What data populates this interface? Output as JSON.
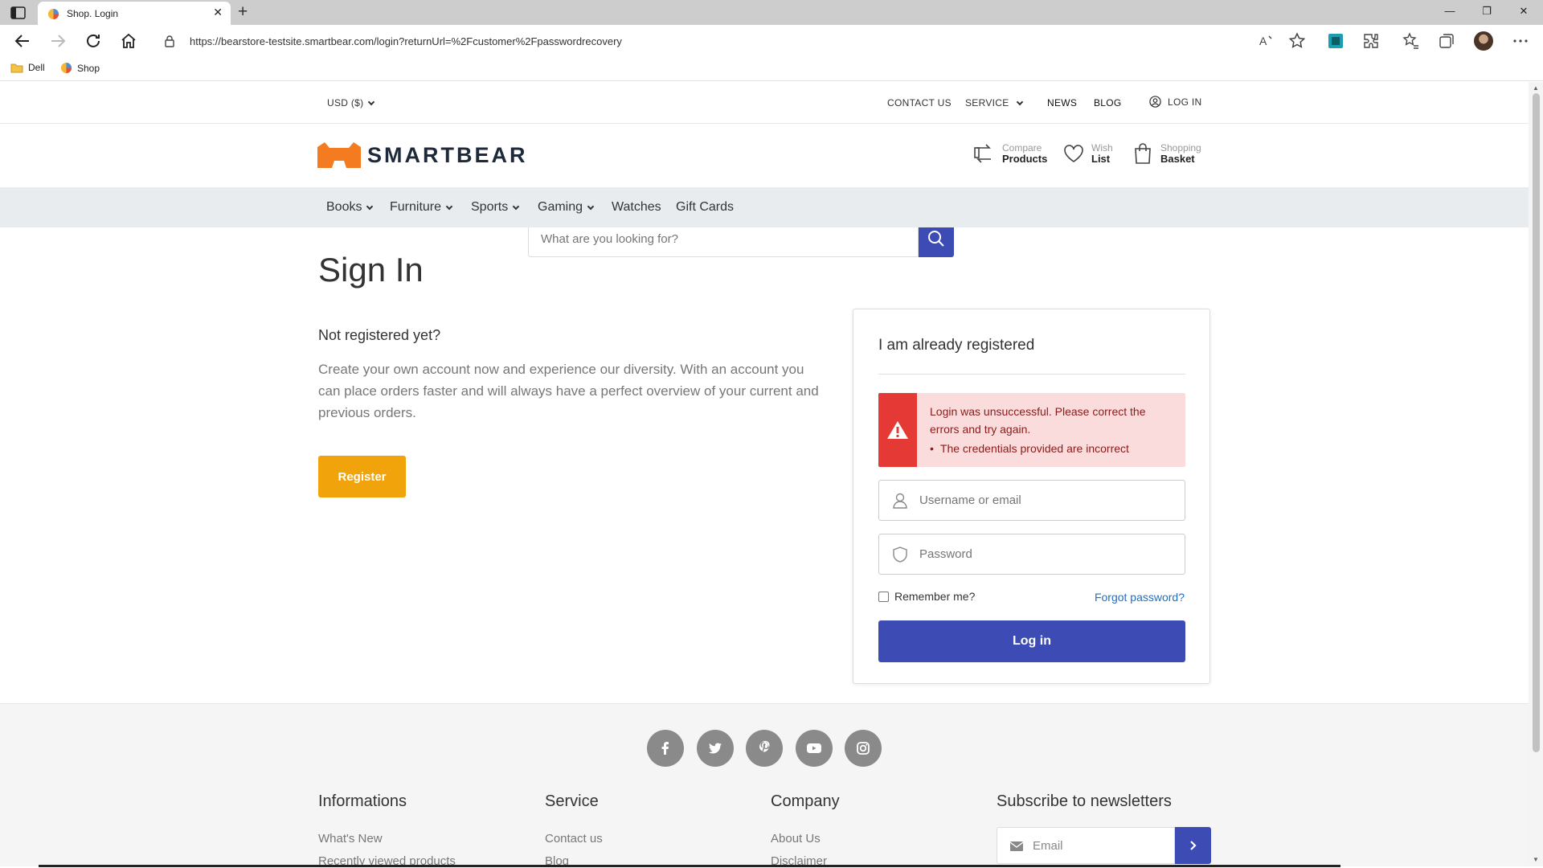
{
  "browser": {
    "tab_title": "Shop. Login",
    "url": "https://bearstore-testsite.smartbear.com/login?returnUrl=%2Fcustomer%2Fpasswordrecovery",
    "bookmarks": [
      {
        "label": "Dell",
        "icon": "folder-icon"
      },
      {
        "label": "Shop",
        "icon": "shop-favicon"
      }
    ]
  },
  "topbar": {
    "currency": "USD ($)",
    "contact": "CONTACT US",
    "service": "SERVICE",
    "news": "NEWS",
    "blog": "BLOG",
    "login": "LOG IN"
  },
  "header": {
    "logo_text": "SMARTBEAR",
    "search_placeholder": "What are you looking for?",
    "compare": {
      "small": "Compare",
      "big": "Products"
    },
    "wish": {
      "small": "Wish",
      "big": "List"
    },
    "basket": {
      "small": "Shopping",
      "big": "Basket"
    }
  },
  "categories": [
    "Books",
    "Furniture",
    "Sports",
    "Gaming",
    "Watches",
    "Gift Cards"
  ],
  "main": {
    "title": "Sign In",
    "not_registered": "Not registered yet?",
    "register_text": "Create your own account now and experience our diversity. With an account you can place orders faster and will always have a perfect overview of your current and previous orders.",
    "register_button": "Register"
  },
  "login": {
    "title": "I am already registered",
    "error_message": "Login was unsuccessful. Please correct the errors and try again.",
    "error_detail": "The credentials provided are incorrect",
    "username_placeholder": "Username or email",
    "password_placeholder": "Password",
    "remember": "Remember me?",
    "forgot": "Forgot password?",
    "button": "Log in"
  },
  "footer": {
    "socials": [
      "facebook-icon",
      "twitter-icon",
      "pinterest-icon",
      "youtube-icon",
      "instagram-icon"
    ],
    "informations": {
      "title": "Informations",
      "links": [
        "What's New",
        "Recently viewed products"
      ]
    },
    "service": {
      "title": "Service",
      "links": [
        "Contact us",
        "Blog"
      ]
    },
    "company": {
      "title": "Company",
      "links": [
        "About Us",
        "Disclaimer"
      ]
    },
    "newsletter": {
      "title": "Subscribe to newsletters",
      "placeholder": "Email"
    }
  },
  "colors": {
    "brand_orange": "#f47b20",
    "primary_blue": "#3d4bb5",
    "register_orange": "#f0a30a",
    "error_red": "#e53935",
    "error_bg": "#fbdcdc"
  }
}
